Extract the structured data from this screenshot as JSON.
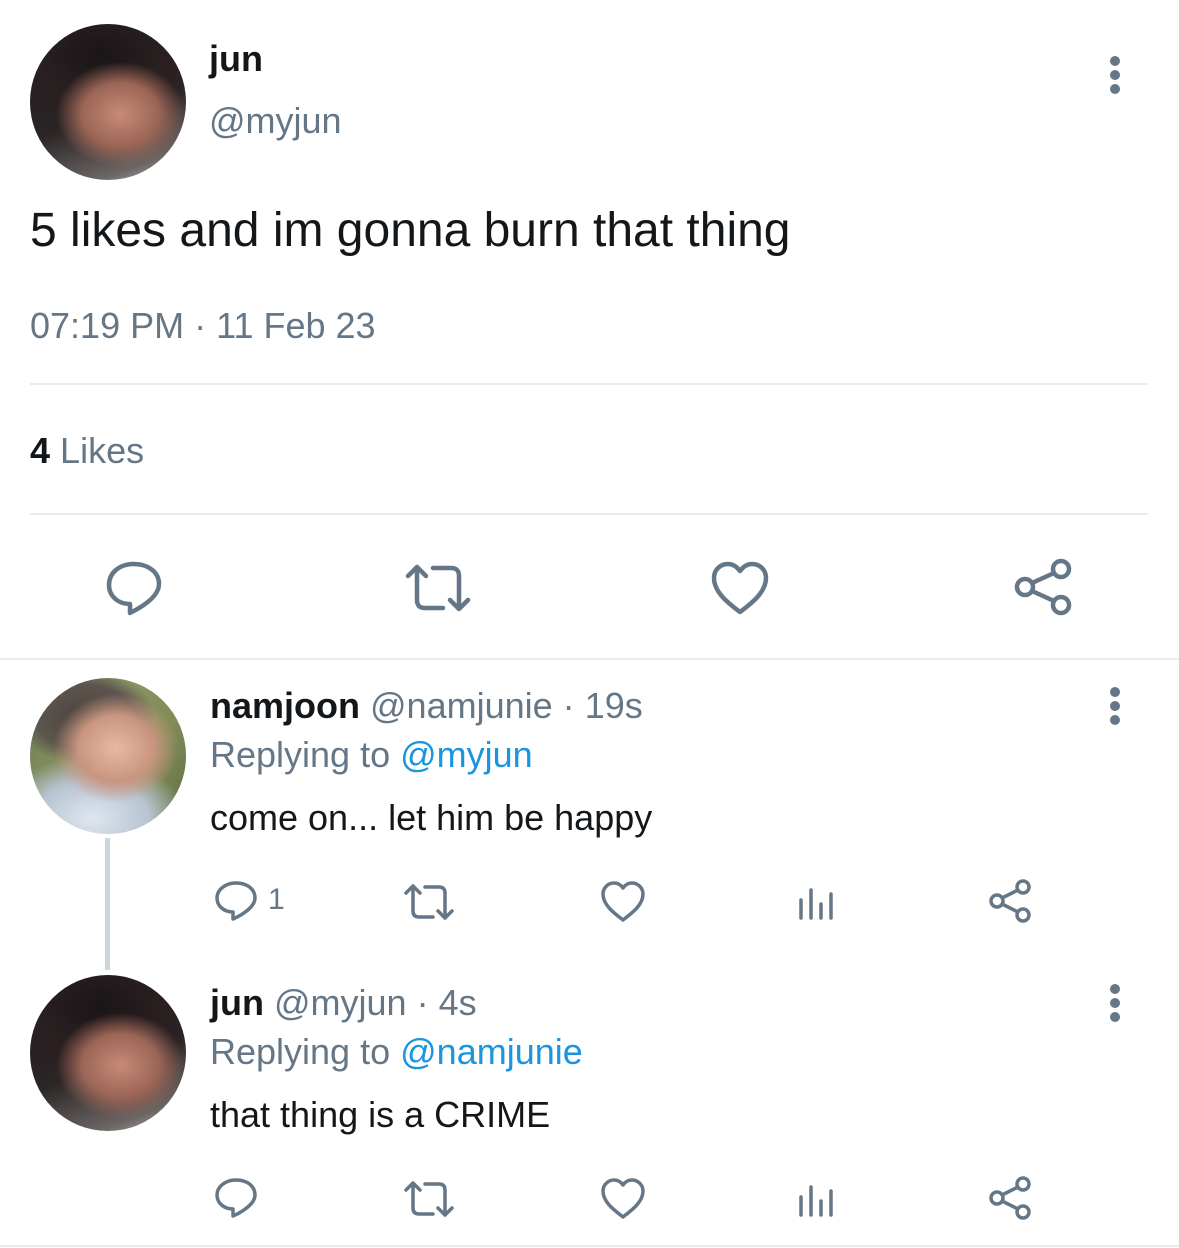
{
  "main_tweet": {
    "display_name": "jun",
    "handle": "@myjun",
    "text": "5 likes and im gonna burn that thing",
    "time": "07:19 PM",
    "date_separator": "·",
    "date": "11 Feb 23",
    "likes_count": "4",
    "likes_label": "Likes"
  },
  "replies": [
    {
      "display_name": "namjoon",
      "handle": "@namjunie",
      "separator": "·",
      "age": "19s",
      "replying_prefix": "Replying to",
      "replying_handle": "@myjun",
      "text": "come on... let him be happy",
      "reply_count": "1"
    },
    {
      "display_name": "jun",
      "handle": "@myjun",
      "separator": "·",
      "age": "4s",
      "replying_prefix": "Replying to",
      "replying_handle": "@namjunie",
      "text": "that thing is a CRIME",
      "reply_count": ""
    }
  ],
  "icons": {
    "more": "more-vertical-icon",
    "reply": "comment-icon",
    "retweet": "retweet-icon",
    "like": "heart-icon",
    "share": "share-icon",
    "analytics": "analytics-icon"
  },
  "colors": {
    "text": "#14171a",
    "muted": "#657786",
    "link": "#1b95e0",
    "divider": "#e6ecf0"
  }
}
